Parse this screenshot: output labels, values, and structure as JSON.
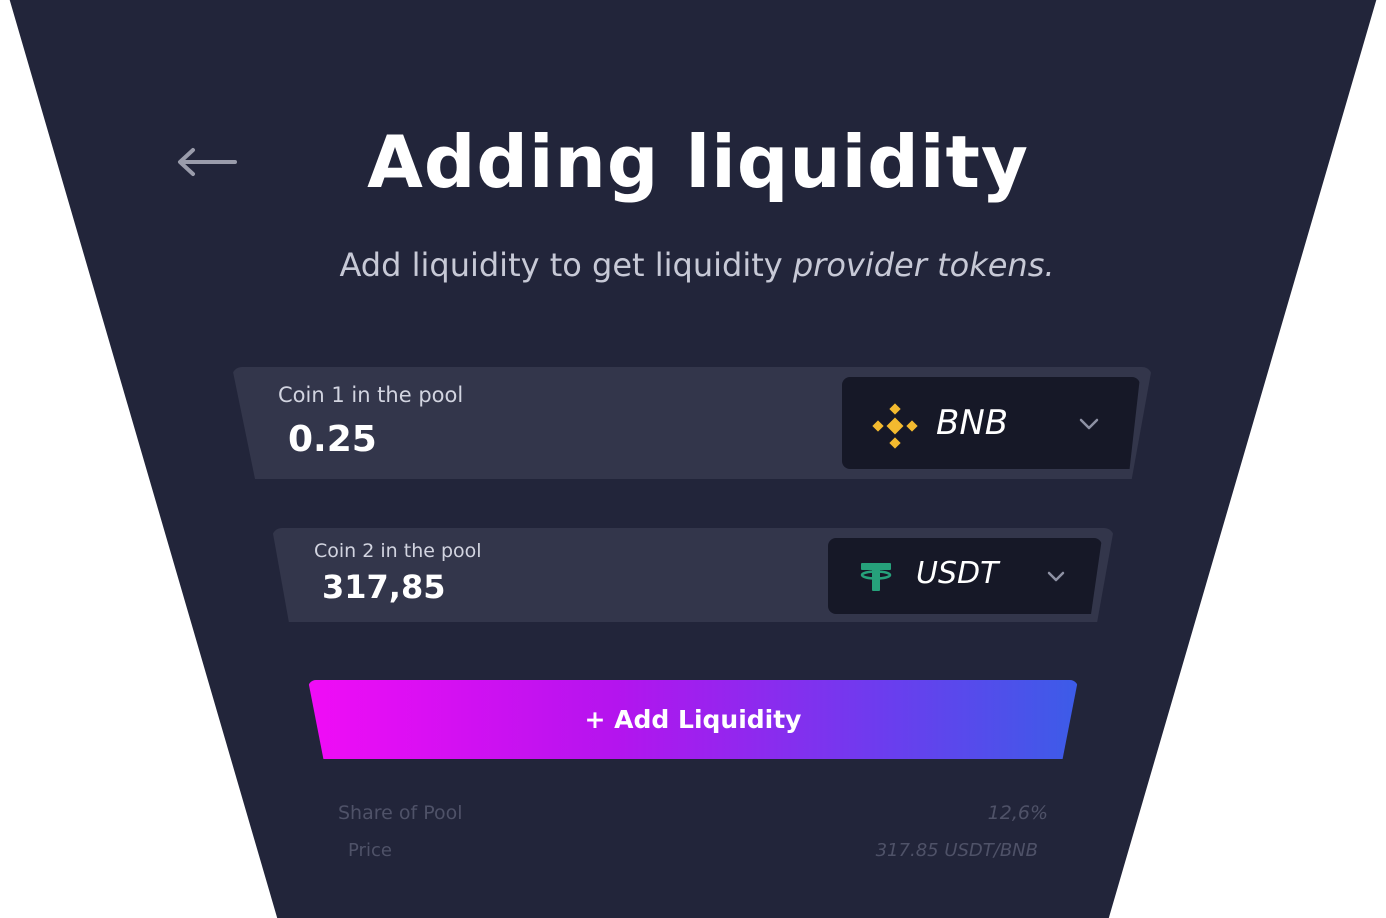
{
  "header": {
    "title": "Adding liquidity",
    "subtitle_main": "Add liquidity to get liquidity",
    "subtitle_em": "provider tokens."
  },
  "coin1": {
    "label": "Coin 1 in the pool",
    "amount": "0.25",
    "token": {
      "name": "BNB",
      "icon": "bnb-icon",
      "color": "#F3BA2F"
    }
  },
  "coin2": {
    "label": "Coin 2 in the pool",
    "amount": "317,85",
    "token": {
      "name": "USDT",
      "icon": "usdt-icon",
      "color": "#26A17B"
    }
  },
  "action": {
    "add_label": "+ Add Liquidity"
  },
  "details": {
    "share_label": "Share of Pool",
    "share_value": "12,6%",
    "price_label": "Price",
    "price_value": "317.85 USDT/BNB"
  },
  "colors": {
    "card_bg": "#22253A",
    "row_bg": "#33364B",
    "selector_bg": "#161827",
    "gradient_start": "#F10CF6",
    "gradient_end": "#3C5CE8"
  }
}
